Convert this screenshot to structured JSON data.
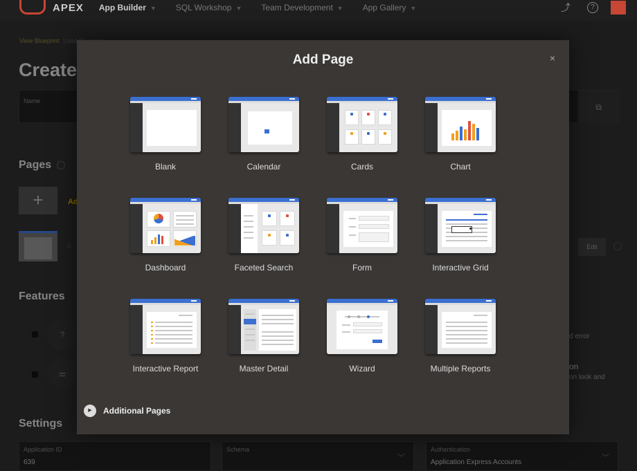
{
  "nav": {
    "brand": "APEX",
    "tabs": [
      {
        "label": "App Builder",
        "active": true
      },
      {
        "label": "SQL Workshop",
        "active": false
      },
      {
        "label": "Team Development",
        "active": false
      },
      {
        "label": "App Gallery",
        "active": false
      }
    ],
    "help_glyph": "?"
  },
  "background": {
    "breadcrumbs": [
      "View Blueprint",
      "Load Blueprint"
    ],
    "title": "Create",
    "name_label": "Name",
    "pages_heading": "Pages",
    "add_page_prefix": "Ad",
    "edit_label": "Edit",
    "features_heading": "Features",
    "feature_snippet_1": "d error",
    "feature_snippet_2a": "on",
    "feature_snippet_2b": "on look and",
    "settings_heading": "Settings",
    "fields": [
      {
        "label": "Application ID",
        "value": "639"
      },
      {
        "label": "Schema",
        "value": ""
      },
      {
        "label": "Authentication",
        "value": "Application Express Accounts"
      }
    ]
  },
  "dialog": {
    "title": "Add Page",
    "close_glyph": "×",
    "tiles": [
      {
        "label": "Blank",
        "icon": "blank-page-icon"
      },
      {
        "label": "Calendar",
        "icon": "calendar-page-icon"
      },
      {
        "label": "Cards",
        "icon": "cards-page-icon"
      },
      {
        "label": "Chart",
        "icon": "chart-page-icon"
      },
      {
        "label": "Dashboard",
        "icon": "dashboard-page-icon"
      },
      {
        "label": "Faceted Search",
        "icon": "faceted-search-page-icon"
      },
      {
        "label": "Form",
        "icon": "form-page-icon"
      },
      {
        "label": "Interactive Grid",
        "icon": "interactive-grid-page-icon"
      },
      {
        "label": "Interactive Report",
        "icon": "interactive-report-page-icon"
      },
      {
        "label": "Master Detail",
        "icon": "master-detail-page-icon"
      },
      {
        "label": "Wizard",
        "icon": "wizard-page-icon"
      },
      {
        "label": "Multiple Reports",
        "icon": "multiple-reports-page-icon"
      }
    ],
    "additional_pages_label": "Additional Pages"
  },
  "colors": {
    "accent_blue": "#3b6fd0",
    "brand_red": "#c74634",
    "dialog_bg": "#3a3735"
  }
}
